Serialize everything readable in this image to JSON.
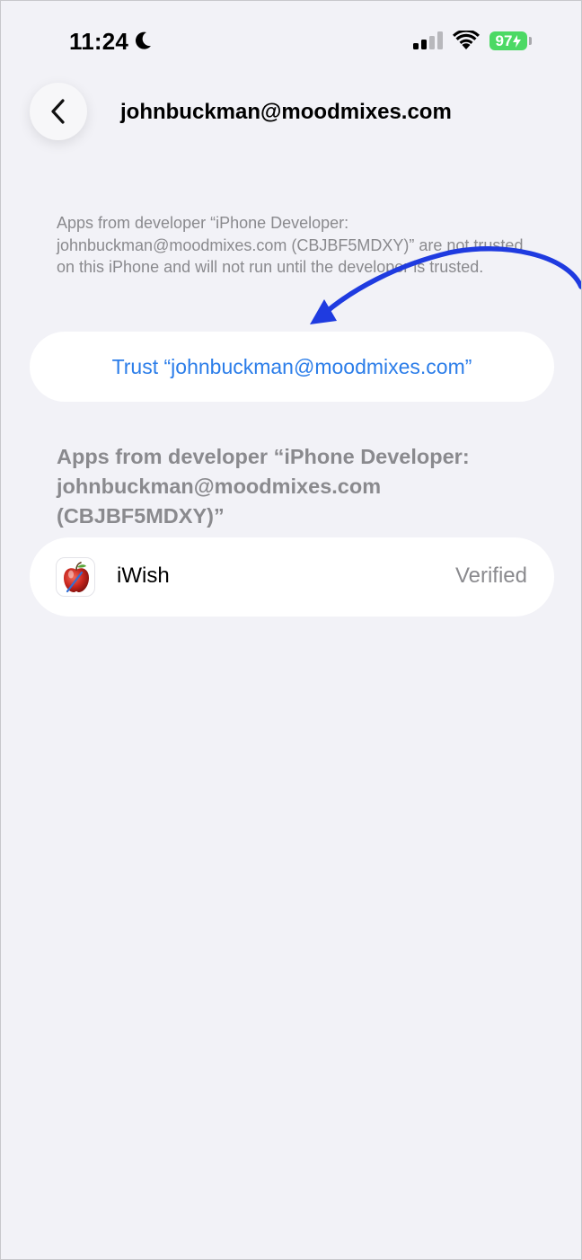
{
  "status_bar": {
    "time": "11:24",
    "battery": "97",
    "icons": [
      "moon-icon",
      "cellular-signal-icon",
      "wifi-icon",
      "battery-charging-icon"
    ]
  },
  "nav": {
    "title": "johnbuckman@moodmixes.com",
    "back_icon": "chevron-left-icon"
  },
  "description": "Apps from developer “iPhone Developer: johnbuckman@moodmixes.com (CBJBF5MDXY)” are not trusted on this iPhone and will not run until the developer is trusted.",
  "trust_button": {
    "label": "Trust “johnbuckman@moodmixes.com”"
  },
  "apps_section": {
    "header": "Apps from developer “iPhone Developer: johnbuckman@moodmixes.com (CBJBF5MDXY)”",
    "apps": [
      {
        "name": "iWish",
        "status": "Verified",
        "icon": "apple-app-icon"
      }
    ]
  },
  "annotation": {
    "arrow_color": "#1f3be0",
    "arrow_icon": "curved-arrow-icon"
  },
  "colors": {
    "background": "#f2f2f7",
    "card": "#ffffff",
    "link_blue": "#2b7de9",
    "secondary_text": "#8a8a8e",
    "battery_green": "#4cd964"
  }
}
